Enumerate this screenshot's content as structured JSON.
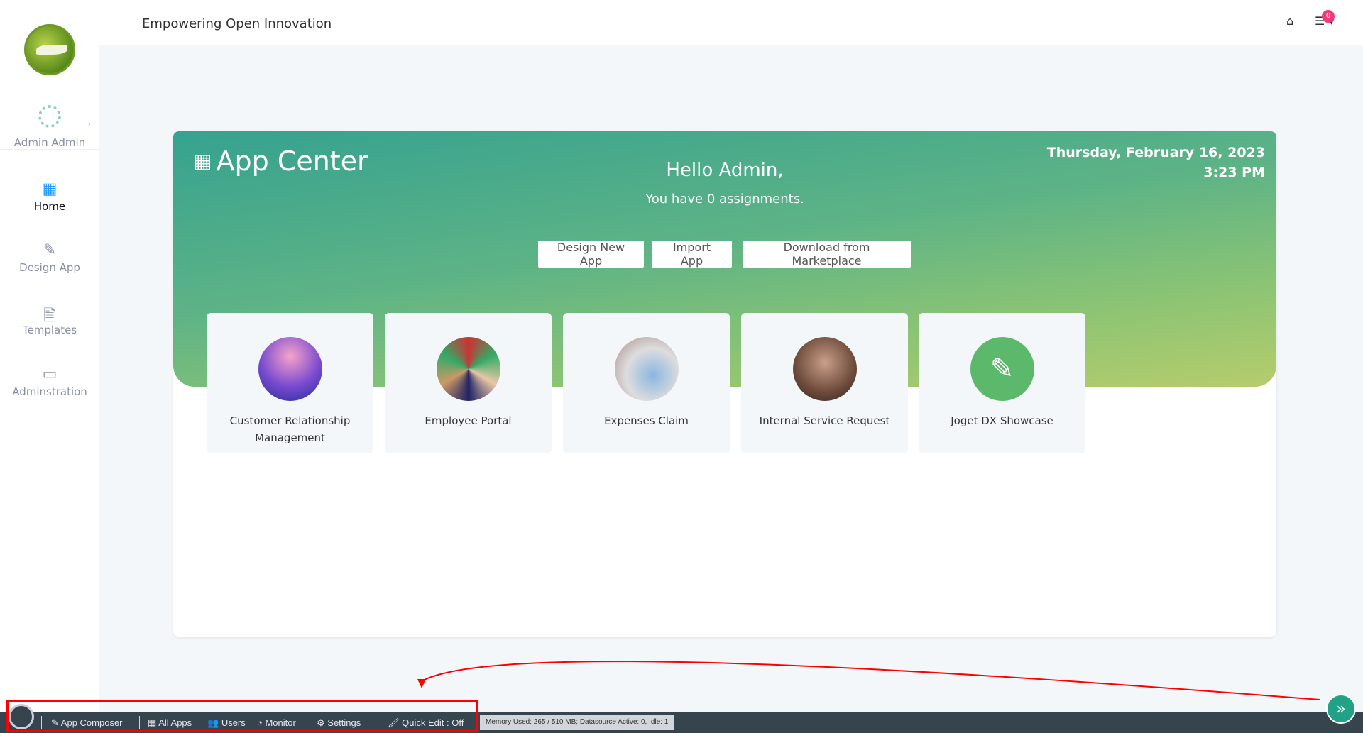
{
  "header": {
    "title": "Empowering Open Innovation",
    "notification_count": "0"
  },
  "sidebar": {
    "user": "Admin Admin",
    "items": [
      {
        "label": "Home",
        "icon": "grid-icon"
      },
      {
        "label": "Design App",
        "icon": "tools-icon"
      },
      {
        "label": "Templates",
        "icon": "file-zip-icon"
      },
      {
        "label": "Adminstration",
        "icon": "console-icon"
      }
    ]
  },
  "banner": {
    "title": "App Center",
    "greeting": "Hello Admin,",
    "assignments": "You have 0 assignments.",
    "date": "Thursday, February 16, 2023",
    "time": "3:23 PM",
    "buttons": [
      "Design New App",
      "Import App",
      "Download from Marketplace"
    ]
  },
  "apps": [
    {
      "name": "Customer Relationship Management"
    },
    {
      "name": "Employee Portal"
    },
    {
      "name": "Expenses Claim"
    },
    {
      "name": "Internal Service Request"
    },
    {
      "name": "Joget DX Showcase"
    }
  ],
  "bottombar": {
    "items": [
      "App Composer",
      "All Apps",
      "Users",
      "Monitor",
      "Settings",
      "Quick Edit : Off"
    ],
    "memory": "Memory Used: 265 / 510 MB; Datasource Active: 0, Idle: 1"
  },
  "colors": {
    "accent": "#1e9bff",
    "banner_start": "#36a28f",
    "banner_end": "#b6cc6c",
    "bar": "#36444e",
    "badge": "#f23a7a"
  }
}
